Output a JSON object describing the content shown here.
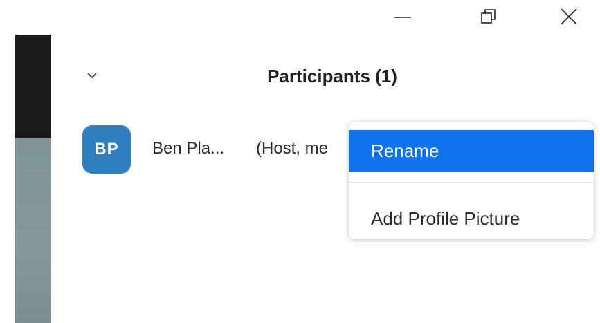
{
  "window_controls": {
    "minimize_icon": "minimize-icon",
    "restore_icon": "restore-icon",
    "close_icon": "close-icon"
  },
  "panel": {
    "title": "Participants (1)",
    "collapse_icon": "chevron-down-icon"
  },
  "participants": [
    {
      "initials": "BP",
      "name": "Ben Pla...",
      "role": "(Host, me",
      "avatar_color": "#2d7fc0"
    }
  ],
  "context_menu": {
    "items": [
      {
        "label": "Rename",
        "highlighted": true
      },
      {
        "label": "Add Profile Picture",
        "highlighted": false
      }
    ],
    "highlight_color": "#0e72ed"
  },
  "colors": {
    "strip_dark": "#1b1b1b",
    "strip_teal": "#82979a"
  }
}
